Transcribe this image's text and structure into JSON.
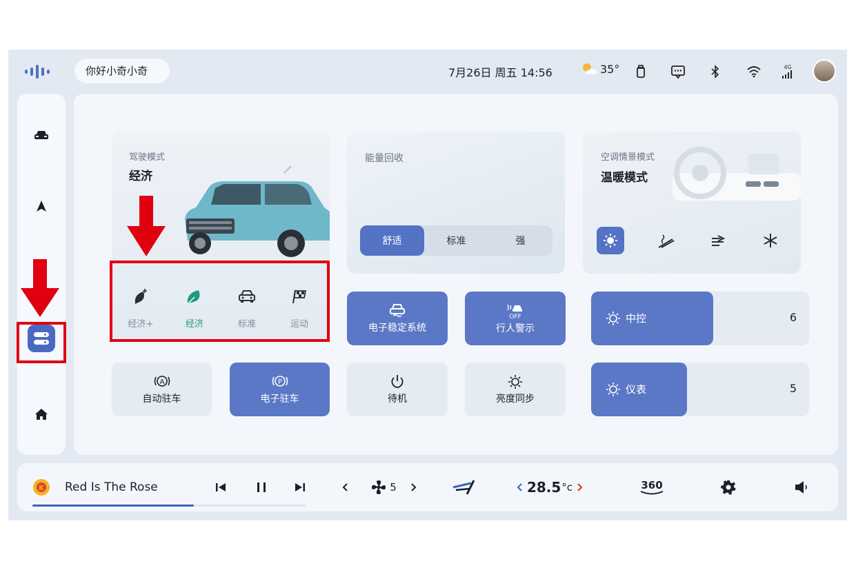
{
  "status_bar": {
    "greeting": "你好小奇小奇",
    "datetime": "7月26日 周五 14:56",
    "temperature": "35°",
    "network": "4G"
  },
  "sidebar": {
    "items": [
      {
        "icon": "car-icon"
      },
      {
        "icon": "navigation-icon"
      },
      {
        "icon": "toggles-icon",
        "selected": true
      },
      {
        "icon": "home-icon"
      }
    ]
  },
  "drive_mode": {
    "label": "驾驶模式",
    "value": "经济",
    "modes": [
      {
        "label": "经济+",
        "active": false
      },
      {
        "label": "经济",
        "active": true
      },
      {
        "label": "标准",
        "active": false
      },
      {
        "label": "运动",
        "active": false
      }
    ]
  },
  "energy_recovery": {
    "label": "能量回收",
    "options": [
      "舒适",
      "标准",
      "强"
    ],
    "selected": "舒适"
  },
  "ac_scene": {
    "label": "空调情景模式",
    "value": "温暖模式"
  },
  "buttons": {
    "esc": "电子稳定系统",
    "pedestrian_warning": "行人警示",
    "pedestrian_off": "OFF",
    "auto_hold": "自动驻车",
    "epb": "电子驻车",
    "standby": "待机",
    "brightness_sync": "亮度同步"
  },
  "brightness": {
    "center": {
      "label": "中控",
      "value": "6",
      "level": 0.56
    },
    "cluster": {
      "label": "仪表",
      "value": "5",
      "level": 0.44
    }
  },
  "media": {
    "song": "Red Is The Rose",
    "progress": 0.59
  },
  "climate": {
    "fan_speed": "5",
    "temp_value": "28.5",
    "temp_unit": "°c",
    "view_360": "360"
  },
  "colors": {
    "accent": "#5a78c5",
    "eco_green": "#1f9a7e",
    "annotation_red": "#e00010"
  }
}
